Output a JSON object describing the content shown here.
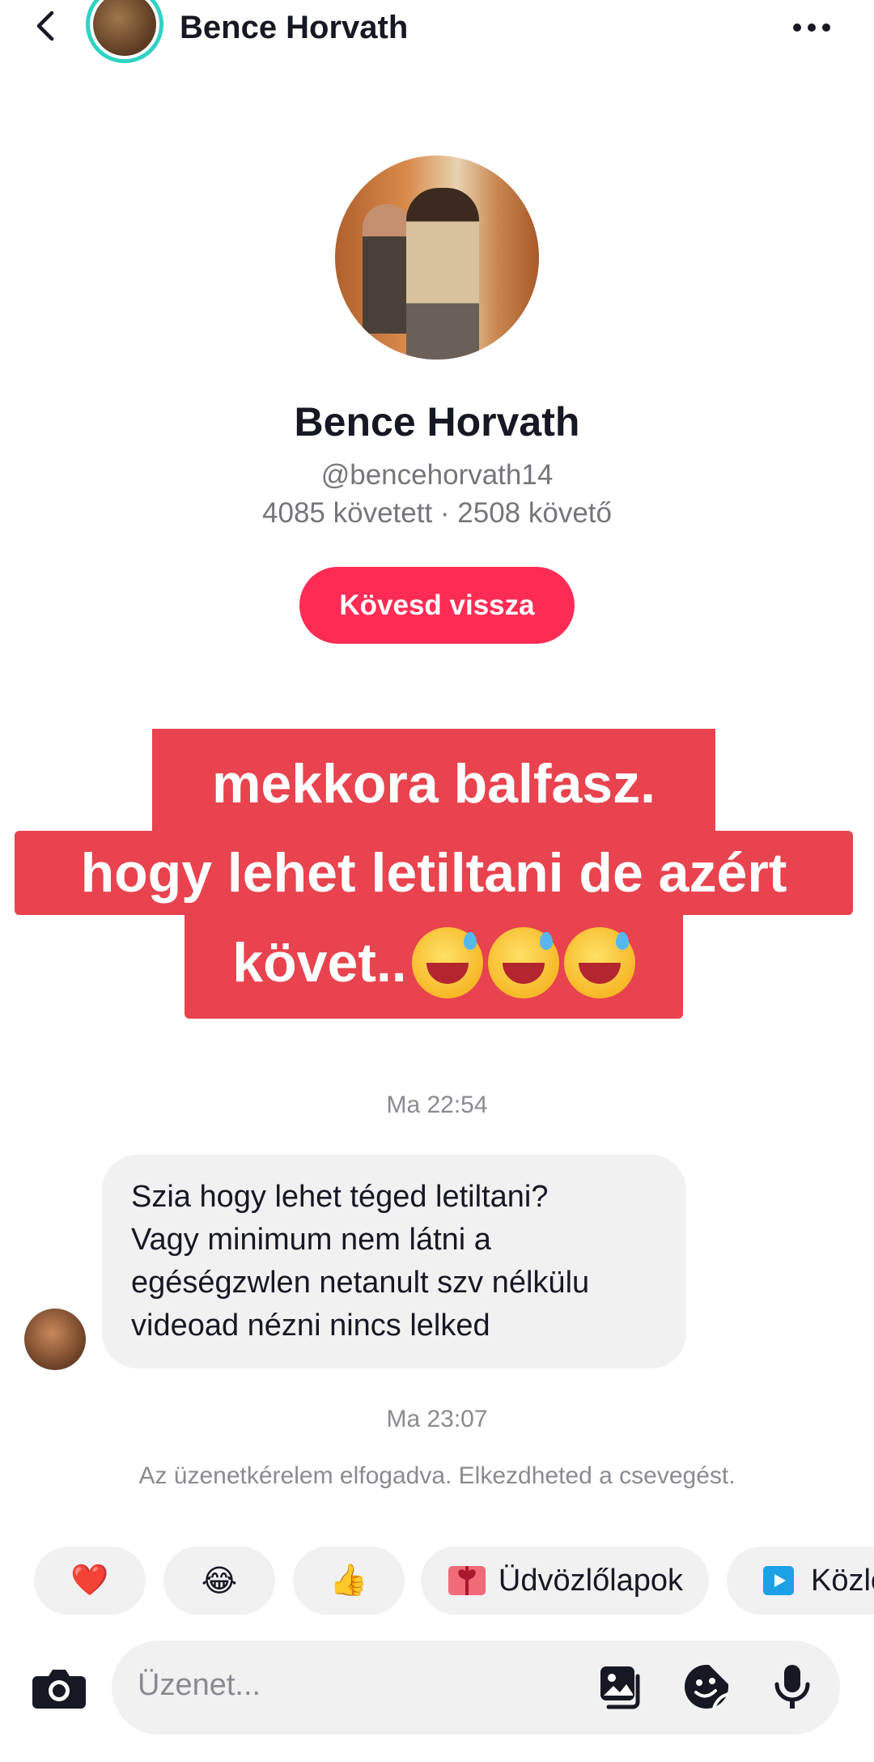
{
  "header": {
    "name": "Bence Horvath"
  },
  "profile": {
    "name": "Bence Horvath",
    "handle": "@bencehorvath14",
    "stats": "4085 követett · 2508 követő",
    "follow_back_label": "Kövesd vissza"
  },
  "caption": {
    "line1": "mekkora balfasz.",
    "line2": "hogy lehet letiltani de azért",
    "line3": "követ.."
  },
  "chat": {
    "time1": "Ma 22:54",
    "message_lines": [
      "Szia hogy lehet téged letiltani?",
      "Vagy minimum nem látni a",
      "egéségzwlen netanult szv nélkülu",
      "videoad nézni nincs lelked"
    ],
    "time2": "Ma 23:07",
    "system_notice": "Az üzenetkérelem elfogadva. Elkezdheted a csevegést."
  },
  "quick_replies": {
    "heart": "❤️",
    "laugh": "😂",
    "thumbs": "👍",
    "cards": "Üdvözlőlapok",
    "announce": "Közle"
  },
  "composer": {
    "placeholder": "Üzenet..."
  },
  "colors": {
    "accent": "#fe2c55",
    "caption_bg": "#e8434e",
    "ring": "#2fd3c3"
  }
}
